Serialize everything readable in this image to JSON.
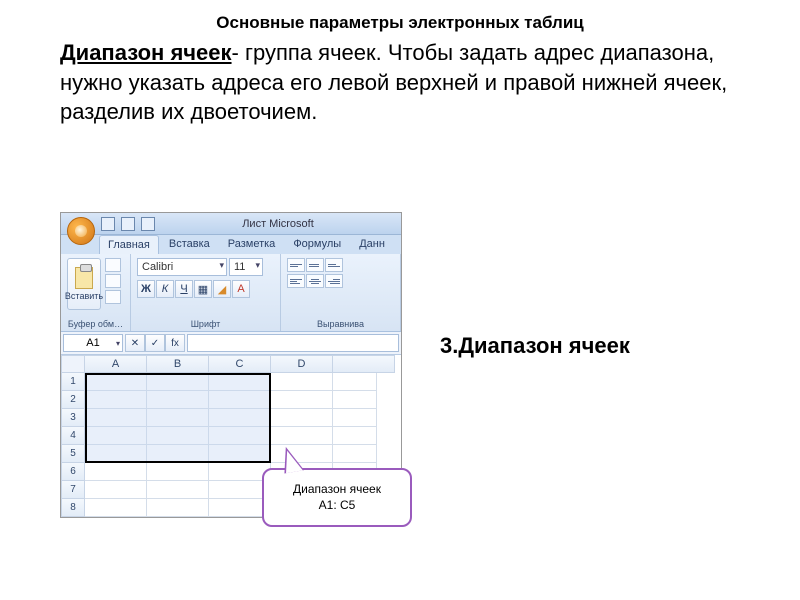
{
  "page_title": "Основные параметры электронных таблиц",
  "definition_term": "Диапазон ячеек",
  "definition_sep": "- ",
  "definition_text": "группа ячеек. Чтобы задать адрес диапазона, нужно указать адреса его левой верхней и правой нижней ячеек,  разделив их двоеточием.",
  "side_caption": "3.Диапазон ячеек",
  "callout_line1": "Диапазон ячеек",
  "callout_line2": "А1: С5",
  "excel": {
    "window_title": "Лист Microsoft",
    "tabs": [
      "Главная",
      "Вставка",
      "Разметка",
      "Формулы",
      "Данн"
    ],
    "paste_label": "Вставить",
    "group_clipboard": "Буфер обм…",
    "group_font": "Шрифт",
    "group_align": "Выравнива",
    "font_name": "Calibri",
    "font_size": "11",
    "namebox": "A1",
    "fx_label": "fx",
    "columns": [
      "A",
      "B",
      "C",
      "D"
    ],
    "rows": [
      "1",
      "2",
      "3",
      "4",
      "5",
      "6",
      "7",
      "8"
    ]
  }
}
